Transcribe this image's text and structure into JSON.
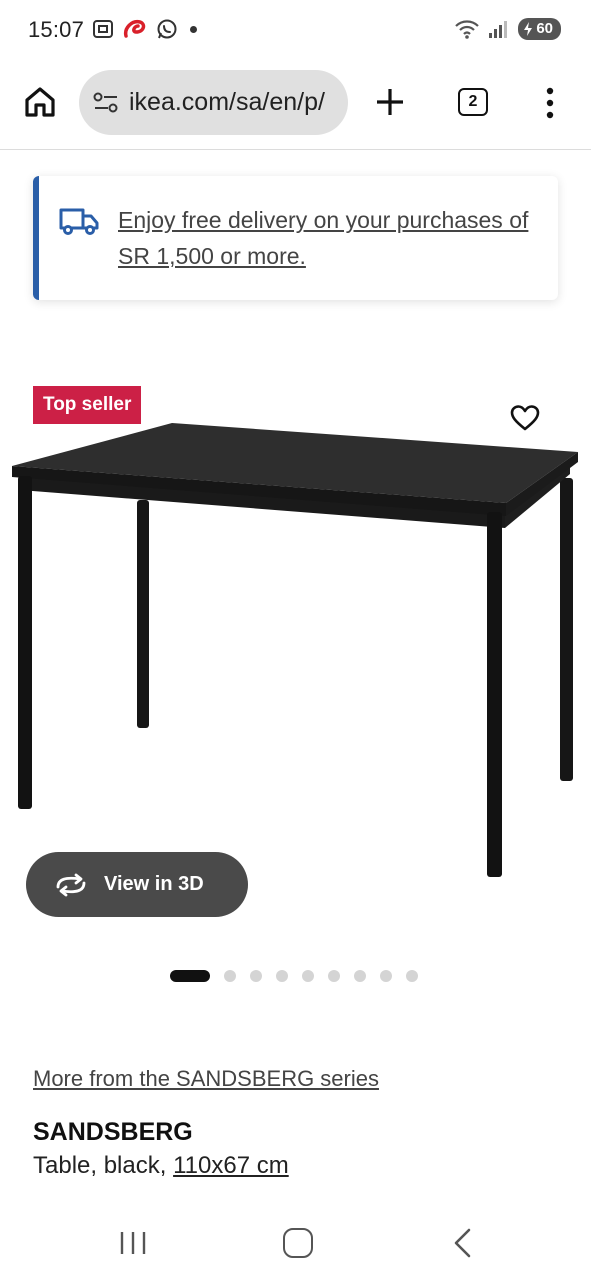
{
  "status_bar": {
    "time": "15:07",
    "battery": "60",
    "icons": [
      "screenshot-icon",
      "airtel-icon",
      "whatsapp-icon",
      "wifi-icon",
      "signal-icon",
      "battery-icon"
    ]
  },
  "browser": {
    "url": "ikea.com/sa/en/p/",
    "tab_count": "2",
    "icons": [
      "home-icon",
      "site-settings-icon",
      "new-tab-icon",
      "more-vert-icon"
    ]
  },
  "delivery_banner": {
    "text": "Enjoy free delivery on your purchases of SR 1,500 or more.",
    "accent_color": "#2a5ea8"
  },
  "product_image": {
    "badge": "Top seller",
    "badge_color": "#cc2046",
    "view3d_label": "View in 3D",
    "carousel": {
      "total": 9,
      "active_index": 0
    }
  },
  "product": {
    "series_link": "More from the SANDSBERG series",
    "name": "SANDSBERG",
    "desc_prefix": "Table, black, ",
    "size": "110x67 cm"
  }
}
